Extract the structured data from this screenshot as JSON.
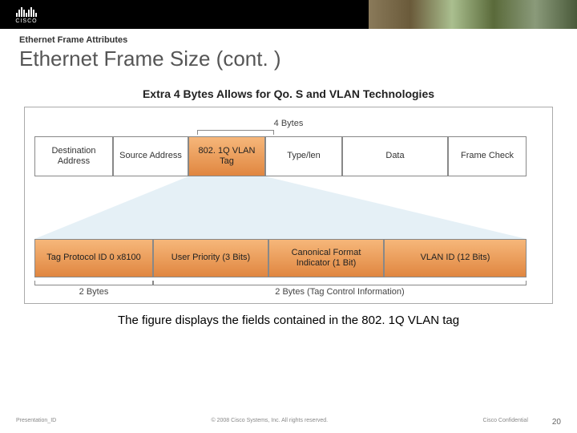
{
  "header": {
    "logo_text": "CISCO"
  },
  "breadcrumb": "Ethernet Frame Attributes",
  "title": "Ethernet Frame Size (cont. )",
  "figure": {
    "title": "Extra 4 Bytes Allows for Qo. S and VLAN Technologies",
    "top_brace": "4 Bytes",
    "row1": {
      "c1": "Destination Address",
      "c2": "Source Address",
      "c3": "802. 1Q VLAN Tag",
      "c4": "Type/len",
      "c5": "Data",
      "c6": "Frame Check"
    },
    "row2": {
      "d1": "Tag Protocol ID 0 x8100",
      "d2": "User Priority (3 Bits)",
      "d3": "Canonical Format Indicator (1 Bit)",
      "d4": "VLAN ID (12 Bits)"
    },
    "bottom": {
      "b1": "2 Bytes",
      "b2": "2 Bytes (Tag Control Information)"
    }
  },
  "caption": "The figure displays the fields contained in the 802. 1Q VLAN tag",
  "footer": {
    "id": "Presentation_ID",
    "copyright": "© 2008 Cisco Systems, Inc. All rights reserved.",
    "confidential": "Cisco Confidential",
    "page": "20"
  }
}
